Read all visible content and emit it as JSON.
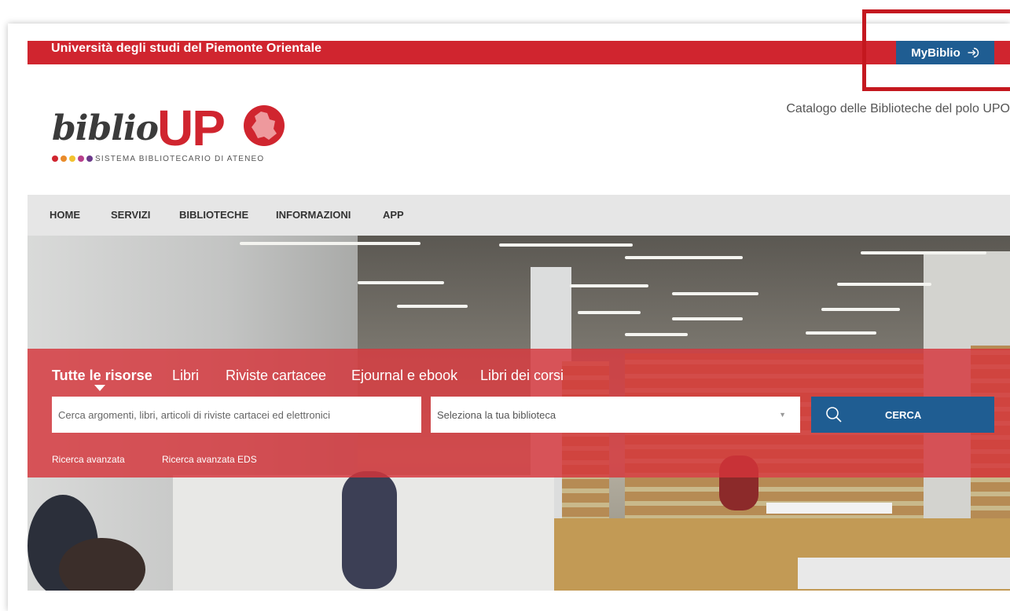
{
  "topbar": {
    "university": "Università degli studi del Piemonte Orientale",
    "mybiblio_label": "MyBiblio"
  },
  "logo": {
    "biblio": "biblio",
    "upo": "UP",
    "subtitle": "SISTEMA BIBLIOTECARIO DI ATENEO"
  },
  "header": {
    "catalog_title": "Catalogo delle Biblioteche del polo UPO"
  },
  "nav": {
    "items": [
      "HOME",
      "SERVIZI",
      "BIBLIOTECHE",
      "INFORMAZIONI",
      "APP"
    ]
  },
  "search": {
    "tabs": [
      "Tutte le risorse",
      "Libri",
      "Riviste cartacee",
      "Ejournal e ebook",
      "Libri dei corsi"
    ],
    "active_tab": "Tutte le risorse",
    "placeholder": "Cerca argomenti, libri, articoli di riviste cartacei ed elettronici",
    "library_select": "Seleziona la tua biblioteca",
    "button_label": "CERCA",
    "advanced": "Ricerca avanzata",
    "advanced_eds": "Ricerca avanzata EDS"
  },
  "colors": {
    "brand_red": "#d0252f",
    "brand_blue": "#1f5d92",
    "highlight": "#c4181f"
  },
  "icons": {
    "mybiblio": "login-arrow-icon",
    "search": "search-icon",
    "select": "caret-down-icon"
  }
}
